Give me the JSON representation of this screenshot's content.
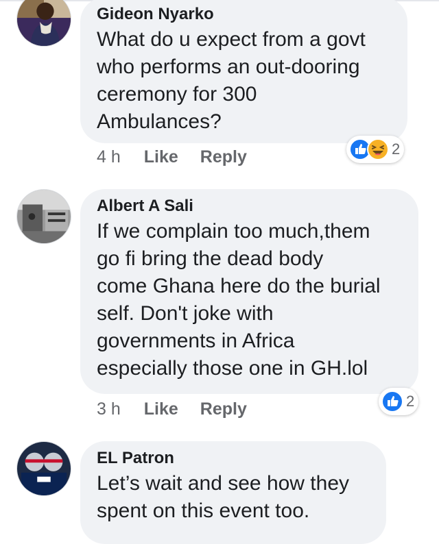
{
  "comments": [
    {
      "author": "Gideon Nyarko",
      "text": "What do u expect from a govt\nwho performs an out-dooring\nceremony for 300\nAmbulances?",
      "time": "4 h",
      "like_label": "Like",
      "reply_label": "Reply",
      "reaction_count": "2",
      "reactions": [
        "like-icon",
        "haha-icon"
      ]
    },
    {
      "author": "Albert A Sali",
      "text": "If we complain too much,them\ngo fi bring the dead body\ncome Ghana here do the burial\nself. Don't joke with\ngovernments in Africa\nespecially those one in GH.lol",
      "time": "3 h",
      "like_label": "Like",
      "reply_label": "Reply",
      "reaction_count": "2",
      "reactions": [
        "like-icon"
      ]
    },
    {
      "author": "EL Patron",
      "text": "Let’s wait and see how they\nspent on this event too."
    }
  ],
  "colors": {
    "bubble": "#f0f2f5",
    "like_blue": "#1877f2",
    "haha_yellow": "#f7b125",
    "meta_gray": "#65676b"
  }
}
